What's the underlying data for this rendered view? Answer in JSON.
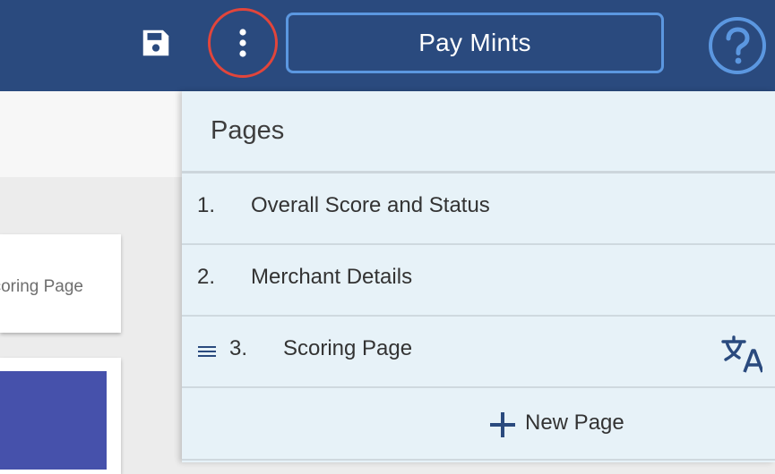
{
  "toolbar": {
    "save_icon": "save-icon",
    "more_icon": "more-vertical-icon",
    "project_name": "Pay Mints",
    "help_icon": "help-circle-icon",
    "highlight_color": "#e2453b",
    "bar_color": "#2a4a7e"
  },
  "editor": {
    "page_card_label": "Scoring Page"
  },
  "pages_panel": {
    "title": "Pages",
    "pages": [
      {
        "number": "1.",
        "name": "Overall Score and Status"
      },
      {
        "number": "2.",
        "name": "Merchant Details"
      },
      {
        "number": "3.",
        "name": "Scoring Page",
        "drag_icon": "drag-handle-icon",
        "translate_icon": "translate-icon"
      }
    ],
    "new_page_label": "New Page",
    "new_page_icon": "plus-icon"
  }
}
